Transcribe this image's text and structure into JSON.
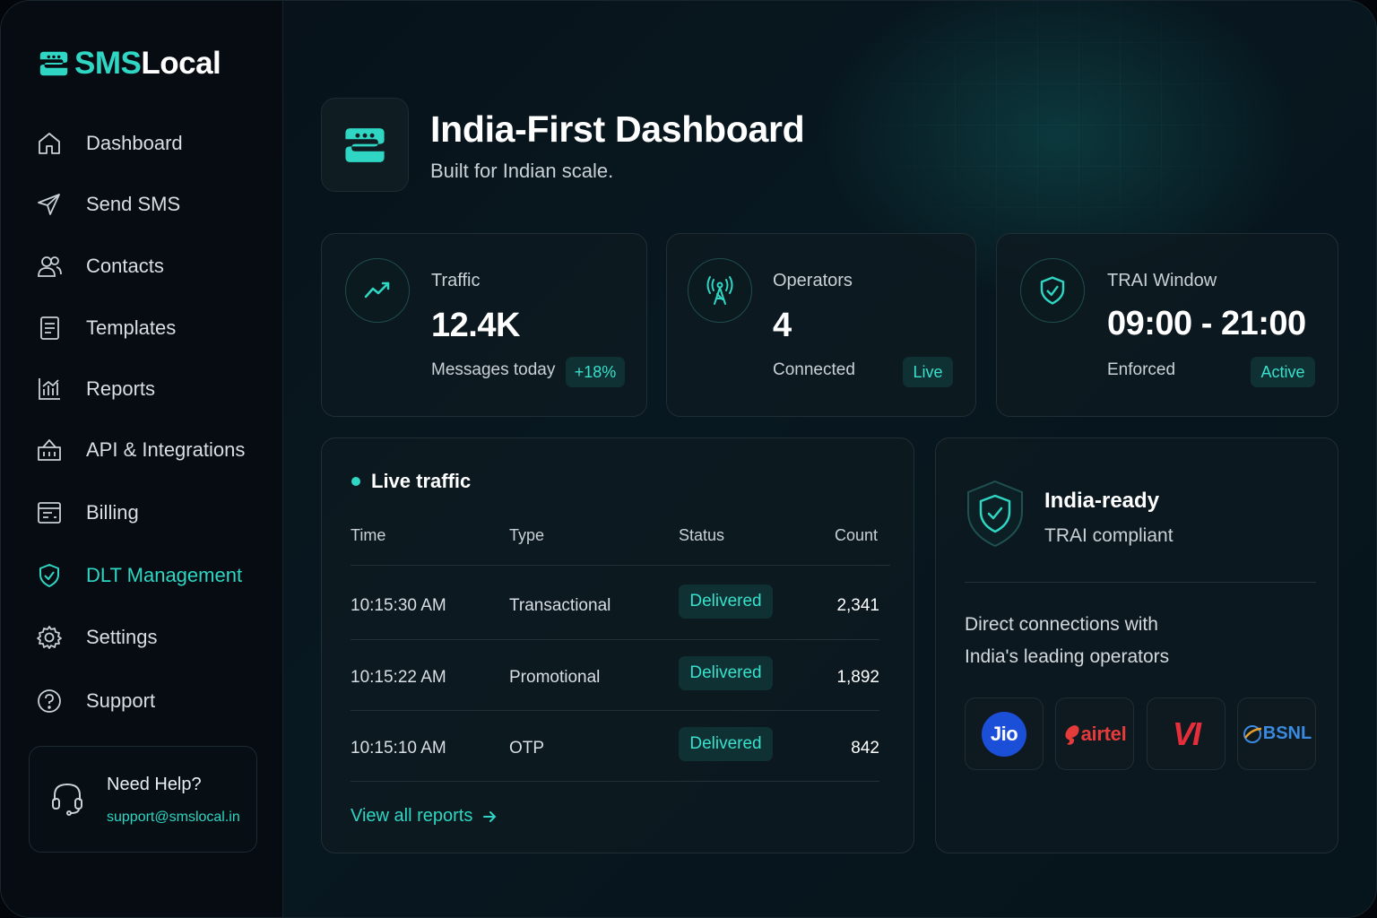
{
  "brand": {
    "name_sms": "SMS",
    "name_local": "Local",
    "accent": "#2fd6c3"
  },
  "sidebar": {
    "items": [
      {
        "label": "Dashboard",
        "icon": "home-icon",
        "active": false
      },
      {
        "label": "Send SMS",
        "icon": "send-icon",
        "active": false
      },
      {
        "label": "Contacts",
        "icon": "users-icon",
        "active": false
      },
      {
        "label": "Templates",
        "icon": "document-icon",
        "active": false
      },
      {
        "label": "Reports",
        "icon": "chart-icon",
        "active": false
      },
      {
        "label": "API & Integrations",
        "icon": "api-basket-icon",
        "active": false
      },
      {
        "label": "Billing",
        "icon": "billing-icon",
        "active": false
      },
      {
        "label": "DLT Management",
        "icon": "shield-check-icon",
        "active": true
      },
      {
        "label": "Settings",
        "icon": "gear-icon",
        "active": false
      },
      {
        "label": "Support",
        "icon": "help-circle-icon",
        "active": false
      }
    ],
    "help": {
      "title": "Need Help?",
      "email": "support@smslocal.in",
      "icon": "headset-icon"
    }
  },
  "header": {
    "title": "India-First Dashboard",
    "subtitle": "Built for Indian scale."
  },
  "stats": [
    {
      "label": "Traffic",
      "value": "12.4K",
      "sub": "Messages today",
      "badge": "+18%",
      "icon": "trend-up-icon"
    },
    {
      "label": "Operators",
      "value": "4",
      "sub": "Connected",
      "badge": "Live",
      "icon": "antenna-icon"
    },
    {
      "label": "TRAI Window",
      "value": "09:00 - 21:00",
      "sub": "Enforced",
      "badge": "Active",
      "icon": "shield-check-icon"
    }
  ],
  "live_traffic": {
    "title": "Live traffic",
    "columns": [
      "Time",
      "Type",
      "Status",
      "Count"
    ],
    "rows": [
      {
        "time": "10:15:30 AM",
        "type": "Transactional",
        "status": "Delivered",
        "count": "2,341"
      },
      {
        "time": "10:15:22 AM",
        "type": "Promotional",
        "status": "Delivered",
        "count": "1,892"
      },
      {
        "time": "10:15:10 AM",
        "type": "OTP",
        "status": "Delivered",
        "count": "842"
      }
    ],
    "view_all": "View all reports"
  },
  "india_ready": {
    "title": "India-ready",
    "subtitle": "TRAI compliant",
    "desc_line1": "Direct connections with",
    "desc_line2": "India's leading operators",
    "operators": [
      {
        "name": "Jio",
        "color": "#1c4fd8"
      },
      {
        "name": "airtel",
        "color": "#e63b3b"
      },
      {
        "name": "VI",
        "color": "#e62e3b"
      },
      {
        "name": "BSNL",
        "color": "#3a8ae0"
      }
    ]
  }
}
